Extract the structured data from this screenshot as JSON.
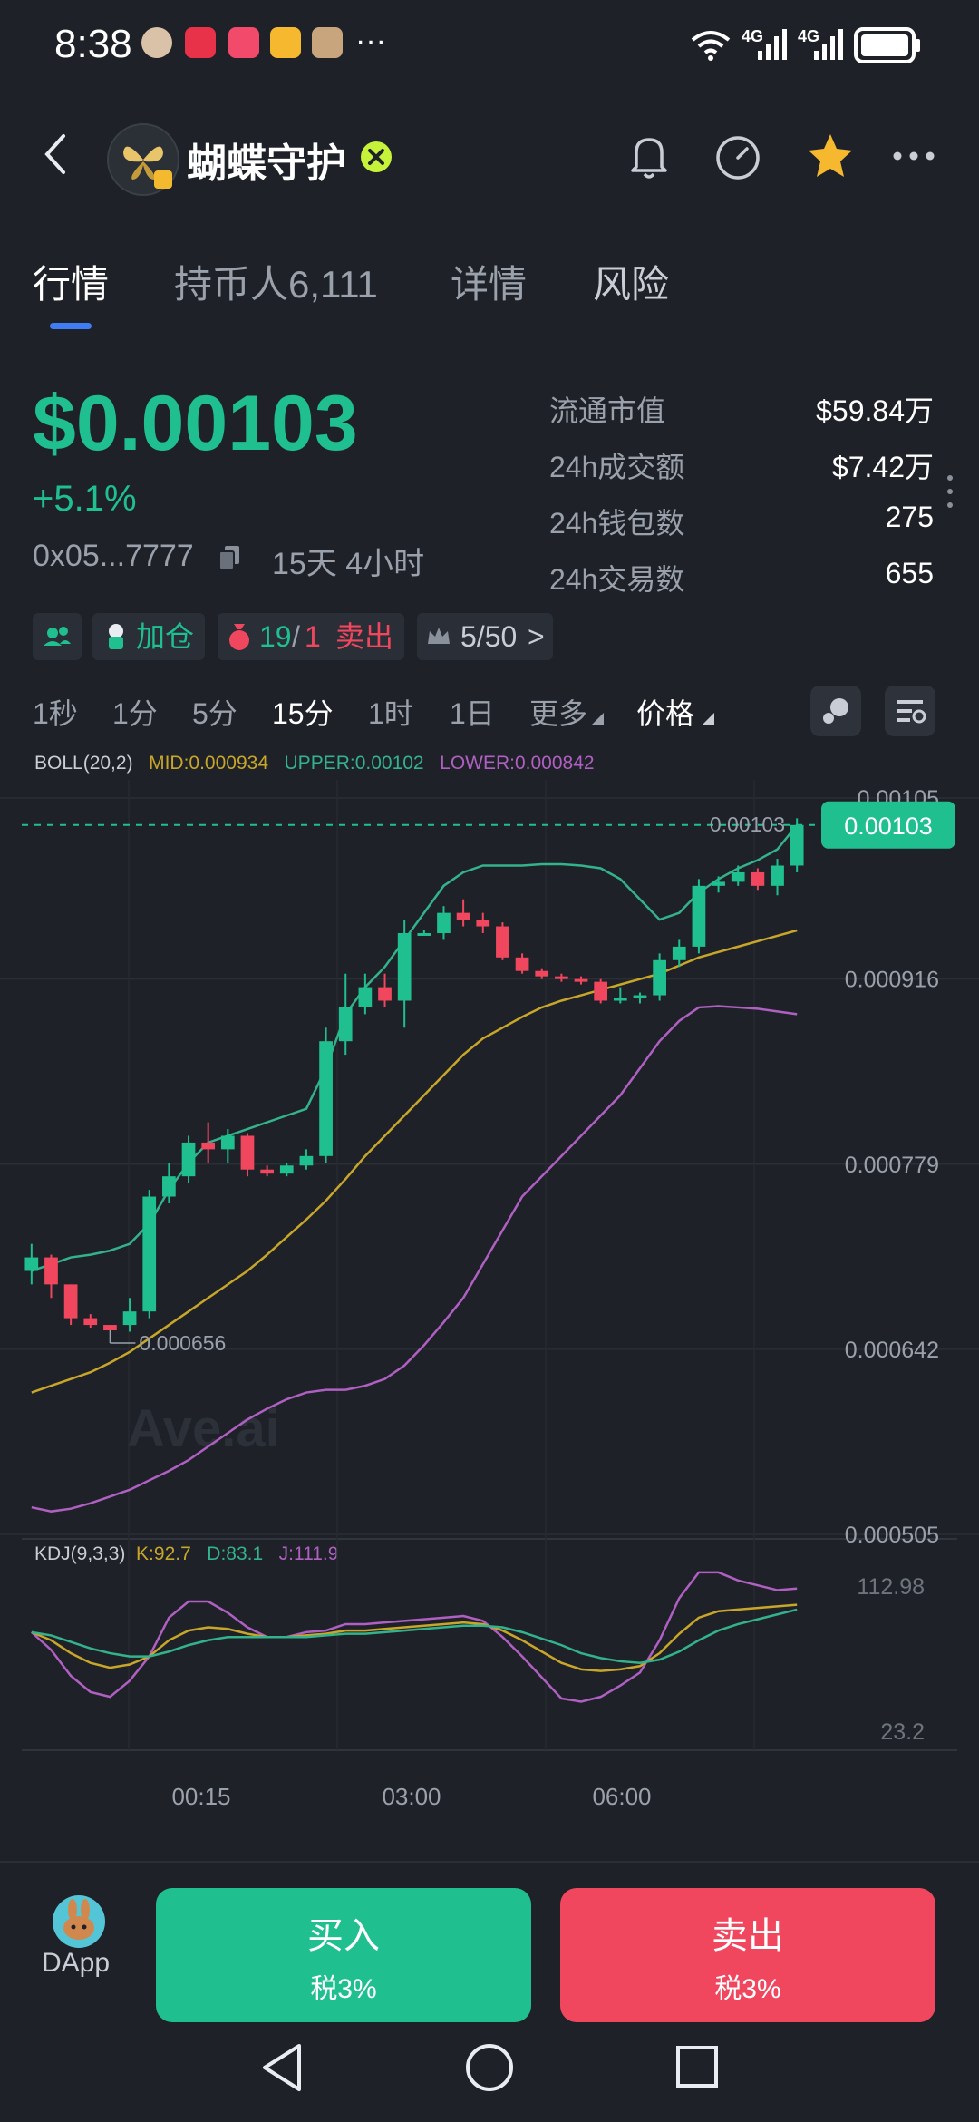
{
  "status_bar": {
    "time": "8:38",
    "network1": "4G",
    "network2": "4G",
    "more": "···"
  },
  "header": {
    "token_name": "蝴蝶守护",
    "icons": [
      "back-icon",
      "bell-icon",
      "speedometer-icon",
      "star-icon",
      "more-icon"
    ]
  },
  "tabs": [
    {
      "label": "行情",
      "active": true
    },
    {
      "label": "持币人6,111",
      "active": false
    },
    {
      "label": "详情",
      "active": false
    },
    {
      "label": "风险",
      "active": false
    }
  ],
  "price": {
    "value": "$0.00103",
    "change": "+5.1%",
    "address": "0x05...7777",
    "age": "15天 4小时"
  },
  "stats": [
    {
      "label": "流通市值",
      "value": "$59.84万"
    },
    {
      "label": "24h成交额",
      "value": "$7.42万"
    },
    {
      "label": "24h钱包数",
      "value": "275"
    },
    {
      "label": "24h交易数",
      "value": "655"
    }
  ],
  "tags": {
    "add_position": "加仓",
    "buy_count": "19",
    "sell_count": "1",
    "sell_label": "卖出",
    "slash": "/",
    "rank": "5/50",
    "rank_arrow": ">"
  },
  "intervals": [
    {
      "label": "1秒",
      "active": false
    },
    {
      "label": "1分",
      "active": false
    },
    {
      "label": "5分",
      "active": false
    },
    {
      "label": "15分",
      "active": true
    },
    {
      "label": "1时",
      "active": false
    },
    {
      "label": "1日",
      "active": false
    }
  ],
  "dropdowns": {
    "more": "更多",
    "price": "价格"
  },
  "colors": {
    "up": "#1fbf8f",
    "down": "#f0475e",
    "mid": "#c8a62a",
    "upper": "#33b28c",
    "lower": "#b05fc2",
    "accent": "#3f7df3"
  },
  "indicators": {
    "boll": {
      "name": "BOLL(20,2)",
      "mid": "MID:0.000934",
      "upper": "UPPER:0.00102",
      "lower": "LOWER:0.000842"
    },
    "kdj": {
      "name": "KDJ(9,3,3)",
      "k": "K:92.7",
      "d": "D:83.1",
      "j": "J:111.9"
    }
  },
  "chart_data": {
    "type": "candlestick",
    "y_ticks": [
      "0.00105",
      "0.000916",
      "0.000779",
      "0.000642",
      "0.000505"
    ],
    "ylim": [
      0.000505,
      0.00105
    ],
    "x_ticks": [
      "00:15",
      "03:00",
      "06:00"
    ],
    "current_price_label": "0.00103",
    "current_price_line_label": "0.00103",
    "low_label": "0.000656",
    "watermark": "Ave.ai",
    "candles": [
      {
        "o": 0.0007,
        "h": 0.00072,
        "l": 0.00069,
        "c": 0.00071
      },
      {
        "o": 0.00071,
        "h": 0.000712,
        "l": 0.00068,
        "c": 0.00069
      },
      {
        "o": 0.00069,
        "h": 0.00069,
        "l": 0.00066,
        "c": 0.000665
      },
      {
        "o": 0.000665,
        "h": 0.000668,
        "l": 0.000658,
        "c": 0.00066
      },
      {
        "o": 0.00066,
        "h": 0.00066,
        "l": 0.000656,
        "c": 0.000656
      },
      {
        "o": 0.00066,
        "h": 0.00068,
        "l": 0.000655,
        "c": 0.00067
      },
      {
        "o": 0.00067,
        "h": 0.00076,
        "l": 0.000665,
        "c": 0.000755
      },
      {
        "o": 0.000755,
        "h": 0.00078,
        "l": 0.00075,
        "c": 0.00077
      },
      {
        "o": 0.00077,
        "h": 0.0008,
        "l": 0.000765,
        "c": 0.000795
      },
      {
        "o": 0.000795,
        "h": 0.00081,
        "l": 0.00078,
        "c": 0.00079
      },
      {
        "o": 0.00079,
        "h": 0.000805,
        "l": 0.00078,
        "c": 0.0008
      },
      {
        "o": 0.0008,
        "h": 0.000802,
        "l": 0.00077,
        "c": 0.000775
      },
      {
        "o": 0.000775,
        "h": 0.000778,
        "l": 0.00077,
        "c": 0.000772
      },
      {
        "o": 0.000772,
        "h": 0.00078,
        "l": 0.00077,
        "c": 0.000778
      },
      {
        "o": 0.000778,
        "h": 0.00079,
        "l": 0.000775,
        "c": 0.000785
      },
      {
        "o": 0.000785,
        "h": 0.00088,
        "l": 0.00078,
        "c": 0.00087
      },
      {
        "o": 0.00087,
        "h": 0.00092,
        "l": 0.00086,
        "c": 0.000895
      },
      {
        "o": 0.000895,
        "h": 0.00092,
        "l": 0.00089,
        "c": 0.00091
      },
      {
        "o": 0.00091,
        "h": 0.00092,
        "l": 0.000895,
        "c": 0.0009
      },
      {
        "o": 0.0009,
        "h": 0.00096,
        "l": 0.00088,
        "c": 0.00095
      },
      {
        "o": 0.00095,
        "h": 0.000952,
        "l": 0.000948,
        "c": 0.00095
      },
      {
        "o": 0.00095,
        "h": 0.00097,
        "l": 0.000945,
        "c": 0.000965
      },
      {
        "o": 0.000965,
        "h": 0.000975,
        "l": 0.000955,
        "c": 0.00096
      },
      {
        "o": 0.00096,
        "h": 0.000965,
        "l": 0.00095,
        "c": 0.000955
      },
      {
        "o": 0.000955,
        "h": 0.000958,
        "l": 0.00093,
        "c": 0.000932
      },
      {
        "o": 0.000932,
        "h": 0.000935,
        "l": 0.00092,
        "c": 0.000922
      },
      {
        "o": 0.000922,
        "h": 0.000924,
        "l": 0.000916,
        "c": 0.000918
      },
      {
        "o": 0.000918,
        "h": 0.00092,
        "l": 0.000914,
        "c": 0.000916
      },
      {
        "o": 0.000916,
        "h": 0.000918,
        "l": 0.000912,
        "c": 0.000914
      },
      {
        "o": 0.000914,
        "h": 0.000916,
        "l": 0.000898,
        "c": 0.0009
      },
      {
        "o": 0.0009,
        "h": 0.00091,
        "l": 0.000898,
        "c": 0.000902
      },
      {
        "o": 0.000902,
        "h": 0.000906,
        "l": 0.000898,
        "c": 0.000904
      },
      {
        "o": 0.000904,
        "h": 0.000935,
        "l": 0.0009,
        "c": 0.00093
      },
      {
        "o": 0.00093,
        "h": 0.000945,
        "l": 0.000925,
        "c": 0.00094
      },
      {
        "o": 0.00094,
        "h": 0.00099,
        "l": 0.000935,
        "c": 0.000985
      },
      {
        "o": 0.000985,
        "h": 0.000992,
        "l": 0.00098,
        "c": 0.000988
      },
      {
        "o": 0.000988,
        "h": 0.001,
        "l": 0.000985,
        "c": 0.000995
      },
      {
        "o": 0.000995,
        "h": 0.000998,
        "l": 0.000982,
        "c": 0.000985
      },
      {
        "o": 0.000985,
        "h": 0.001005,
        "l": 0.000978,
        "c": 0.001
      },
      {
        "o": 0.001,
        "h": 0.001035,
        "l": 0.000995,
        "c": 0.00103
      }
    ],
    "boll_upper": [
      0.0007,
      0.000705,
      0.00071,
      0.000712,
      0.000715,
      0.00072,
      0.000735,
      0.00076,
      0.00078,
      0.000795,
      0.0008,
      0.000805,
      0.00081,
      0.000815,
      0.00082,
      0.00085,
      0.00089,
      0.00091,
      0.000925,
      0.000945,
      0.000965,
      0.000985,
      0.000995,
      0.001,
      0.001,
      0.001,
      0.001001,
      0.001001,
      0.001,
      0.000998,
      0.00099,
      0.000975,
      0.00096,
      0.000965,
      0.00098,
      0.00099,
      0.000998,
      0.001004,
      0.001012,
      0.00103
    ],
    "boll_mid": [
      0.00061,
      0.000615,
      0.00062,
      0.000625,
      0.000632,
      0.00064,
      0.00065,
      0.00066,
      0.00067,
      0.00068,
      0.00069,
      0.0007,
      0.000712,
      0.000725,
      0.000738,
      0.000752,
      0.000768,
      0.000785,
      0.0008,
      0.000815,
      0.00083,
      0.000845,
      0.00086,
      0.000872,
      0.00088,
      0.000888,
      0.000895,
      0.0009,
      0.000904,
      0.000908,
      0.000912,
      0.000916,
      0.00092,
      0.000926,
      0.000932,
      0.000936,
      0.00094,
      0.000944,
      0.000948,
      0.000952
    ],
    "boll_lower": [
      0.000525,
      0.000522,
      0.000524,
      0.000528,
      0.000533,
      0.000538,
      0.000545,
      0.000552,
      0.00056,
      0.00057,
      0.00058,
      0.00059,
      0.000598,
      0.000605,
      0.00061,
      0.000612,
      0.000612,
      0.000615,
      0.00062,
      0.00063,
      0.000645,
      0.000662,
      0.00068,
      0.000705,
      0.00073,
      0.000755,
      0.00077,
      0.000785,
      0.0008,
      0.000815,
      0.00083,
      0.00085,
      0.00087,
      0.000885,
      0.000895,
      0.000896,
      0.000895,
      0.000894,
      0.000892,
      0.00089
    ],
    "kdj_ylim": [
      23.2,
      112.98
    ],
    "kdj_ticks": [
      "112.98",
      "23.2"
    ],
    "kdj_k": [
      85,
      80,
      72,
      66,
      63,
      65,
      70,
      80,
      86,
      88,
      87,
      84,
      82,
      82,
      83,
      84,
      86,
      86,
      87,
      88,
      89,
      90,
      91,
      90,
      86,
      80,
      73,
      66,
      62,
      61,
      62,
      64,
      72,
      84,
      94,
      98,
      99,
      100,
      101,
      102
    ],
    "kdj_d": [
      85,
      83,
      79,
      75,
      72,
      70,
      70,
      73,
      77,
      80,
      82,
      82,
      82,
      82,
      82,
      83,
      84,
      84,
      85,
      86,
      87,
      88,
      89,
      89,
      88,
      85,
      81,
      77,
      72,
      69,
      67,
      66,
      68,
      73,
      80,
      86,
      90,
      93,
      96,
      99
    ],
    "kdj_j": [
      85,
      74,
      58,
      48,
      45,
      55,
      70,
      94,
      104,
      104,
      97,
      88,
      82,
      82,
      85,
      86,
      90,
      90,
      91,
      92,
      93,
      94,
      95,
      92,
      82,
      70,
      57,
      44,
      42,
      45,
      52,
      60,
      80,
      106,
      122,
      122,
      117,
      114,
      111,
      112
    ]
  },
  "bottom": {
    "dapp": "DApp",
    "buy_label": "买入",
    "buy_tax": "税3%",
    "sell_label": "卖出",
    "sell_tax": "税3%"
  }
}
